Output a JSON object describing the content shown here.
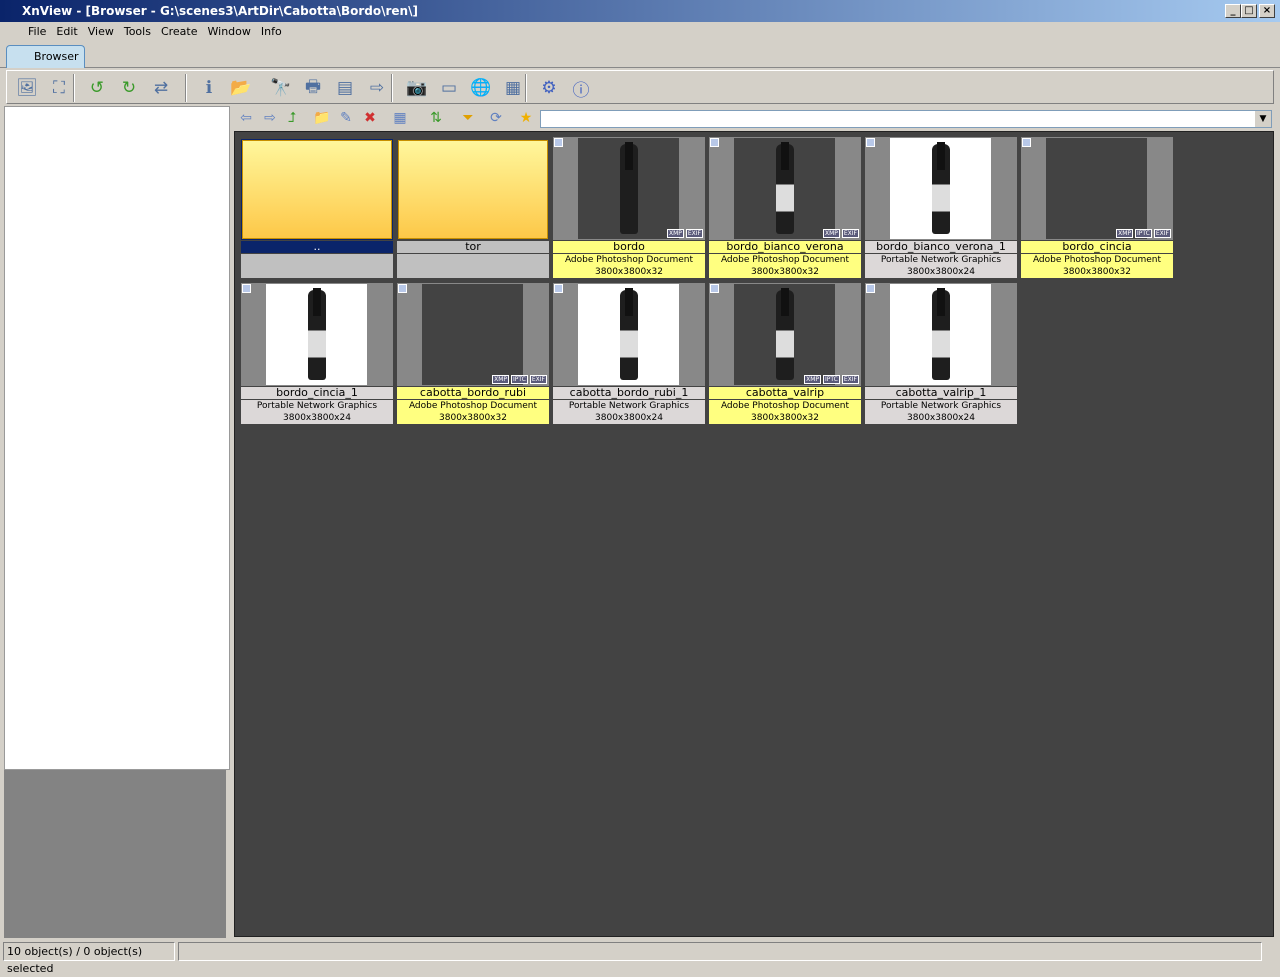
{
  "window": {
    "title": "XnView - [Browser - G:\\scenes3\\ArtDir\\Cabotta\\Bordo\\ren\\]"
  },
  "menu": [
    "File",
    "Edit",
    "View",
    "Tools",
    "Create",
    "Window",
    "Info"
  ],
  "tab": {
    "label": "Browser"
  },
  "toolbar": [
    "view-icon",
    "fullscreen-icon",
    "rotate-left-icon",
    "rotate-right-icon",
    "convert-icon",
    "properties-icon",
    "copy-to-icon",
    "find-icon",
    "print-icon",
    "scan-icon",
    "export-icon",
    "capture-icon",
    "slideshow-icon",
    "web-icon",
    "contact-sheet-icon",
    "settings-icon",
    "info-icon"
  ],
  "nav": [
    "back-icon",
    "forward-icon",
    "up-icon",
    "new-folder-icon",
    "rename-icon",
    "delete-icon",
    "view-mode-icon",
    "sort-icon",
    "filter-icon",
    "refresh-icon",
    "favorite-icon"
  ],
  "items": [
    {
      "name": "..",
      "type": "",
      "dims": "",
      "kind": "folder",
      "selected": true
    },
    {
      "name": "tor",
      "type": "",
      "dims": "",
      "kind": "folder"
    },
    {
      "name": "bordo",
      "type": "Adobe Photoshop Document",
      "dims": "3800x3800x32",
      "kind": "dark",
      "badges": [
        "XMP",
        "EXIF"
      ]
    },
    {
      "name": "bordo_bianco_verona",
      "type": "Adobe Photoshop Document",
      "dims": "3800x3800x32",
      "kind": "dark",
      "badges": [
        "XMP",
        "EXIF"
      ]
    },
    {
      "name": "bordo_bianco_verona_1",
      "type": "Portable Network Graphics",
      "dims": "3800x3800x24",
      "kind": "white",
      "badges": []
    },
    {
      "name": "bordo_cincia",
      "type": "Adobe Photoshop Document",
      "dims": "3800x3800x32",
      "kind": "empty",
      "badges": [
        "XMP",
        "IPTC",
        "EXIF"
      ]
    },
    {
      "name": "bordo_cincia_1",
      "type": "Portable Network Graphics",
      "dims": "3800x3800x24",
      "kind": "white",
      "badges": []
    },
    {
      "name": "cabotta_bordo_rubi",
      "type": "Adobe Photoshop Document",
      "dims": "3800x3800x32",
      "kind": "empty",
      "badges": [
        "XMP",
        "IPTC",
        "EXIF"
      ]
    },
    {
      "name": "cabotta_bordo_rubi_1",
      "type": "Portable Network Graphics",
      "dims": "3800x3800x24",
      "kind": "white",
      "badges": []
    },
    {
      "name": "cabotta_valrip",
      "type": "Adobe Photoshop Document",
      "dims": "3800x3800x32",
      "kind": "dark",
      "badges": [
        "XMP",
        "IPTC",
        "EXIF"
      ]
    },
    {
      "name": "cabotta_valrip_1",
      "type": "Portable Network Graphics",
      "dims": "3800x3800x24",
      "kind": "white",
      "badges": []
    }
  ],
  "colors": {
    "psd": "#ffff80",
    "png": "#dcd8d8",
    "folder": "#c0c0c0",
    "selected": "#0a246a"
  },
  "status": {
    "text": "10 object(s) / 0 object(s) selected"
  }
}
